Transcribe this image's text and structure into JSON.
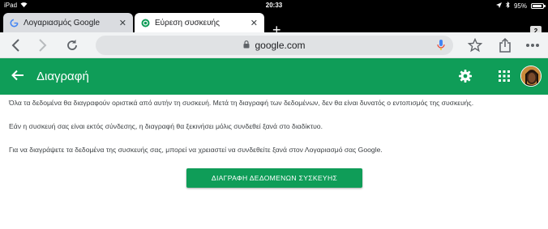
{
  "status_bar": {
    "device": "iPad",
    "time": "20:33",
    "battery": "95%",
    "battery_level": 0.95
  },
  "tabs": [
    {
      "label": "Λογαριασμός Google",
      "favicon": "google-g-icon",
      "active": false
    },
    {
      "label": "Εύρεση συσκευής",
      "favicon": "find-device-icon",
      "active": true
    }
  ],
  "tab_count": "2",
  "toolbar": {
    "url": "google.com"
  },
  "app_bar": {
    "title": "Διαγραφή"
  },
  "content": {
    "paragraphs": [
      "Όλα τα δεδομένα θα διαγραφούν οριστικά από αυτήν τη συσκευή. Μετά τη διαγραφή των δεδομένων, δεν θα είναι δυνατός ο εντοπισμός της συσκευής.",
      "Εάν η συσκευή σας είναι εκτός σύνδεσης, η διαγραφή θα ξεκινήσει μόλις συνδεθεί ξανά στο διαδίκτυο.",
      "Για να διαγράψετε τα δεδομένα της συσκευής σας, μπορεί να χρειαστεί να συνδεθείτε ξανά στον Λογαριασμό σας Google."
    ],
    "button_label": "ΔΙΑΓΡΑΦΗ ΔΕΔΟΜΕΝΩΝ ΣΥΣΚΕΥΗΣ"
  },
  "colors": {
    "brand_green": "#0f9d58",
    "status_bar": "#000000",
    "toolbar": "#f1f3f4"
  }
}
